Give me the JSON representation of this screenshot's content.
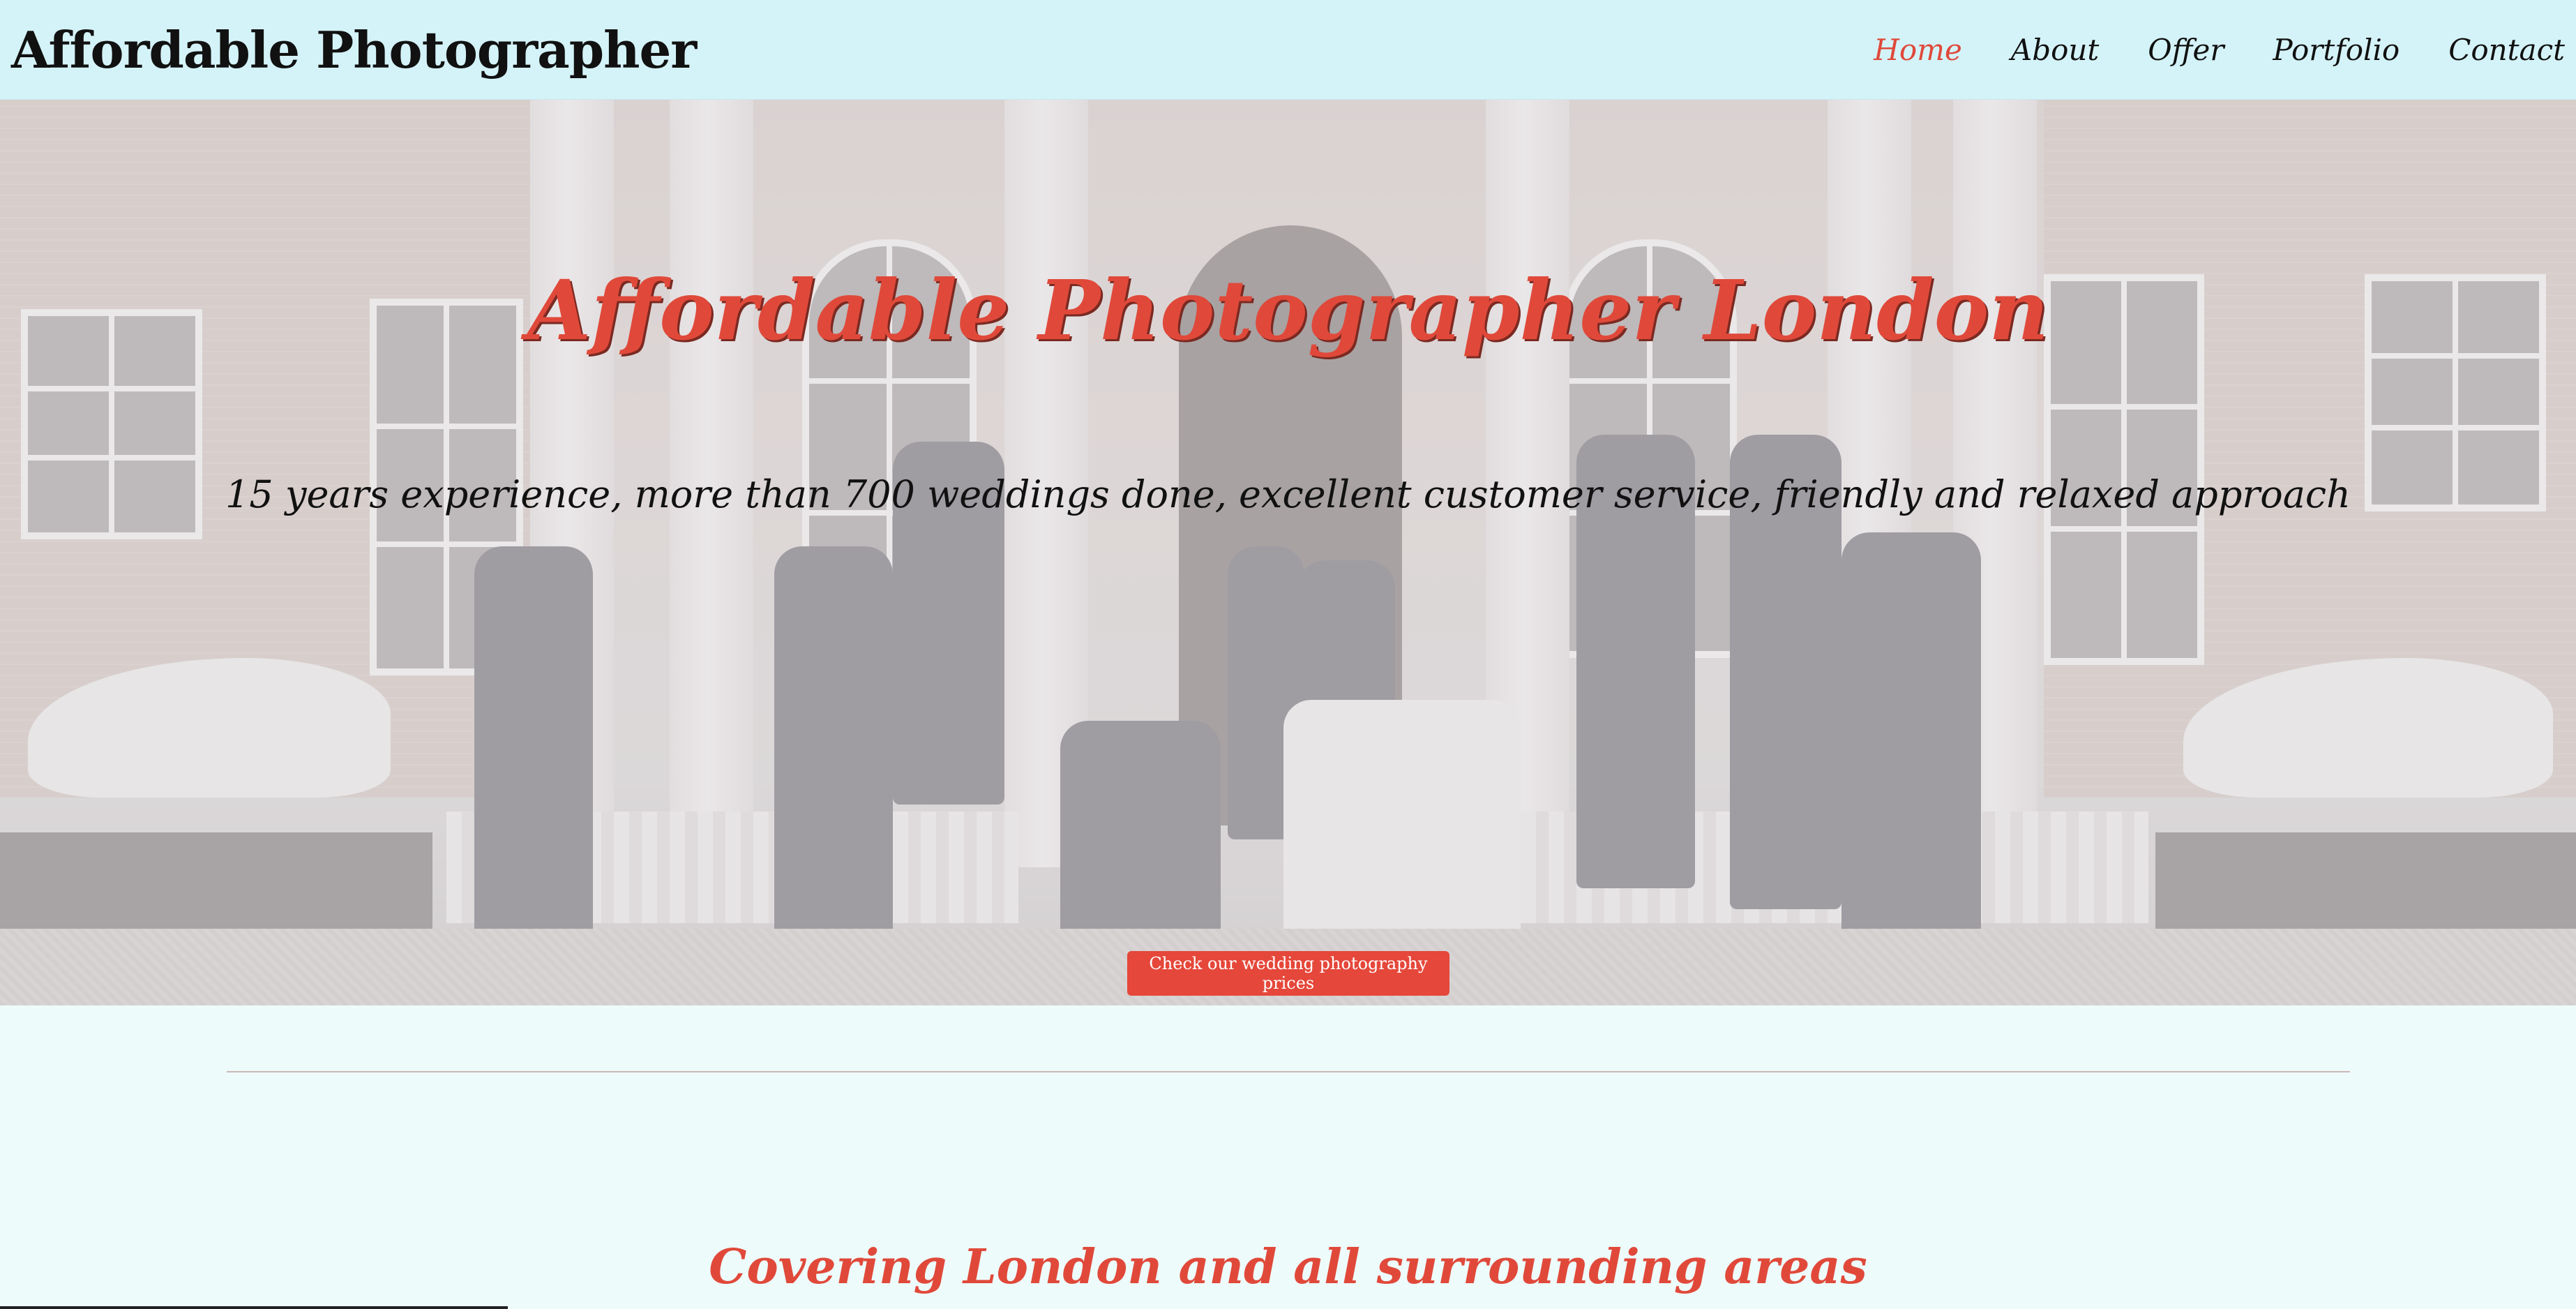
{
  "header": {
    "brand": "Affordable Photographer",
    "nav": [
      {
        "label": "Home",
        "active": true
      },
      {
        "label": "About",
        "active": false
      },
      {
        "label": "Offer",
        "active": false
      },
      {
        "label": "Portfolio",
        "active": false
      },
      {
        "label": "Contact",
        "active": false
      }
    ]
  },
  "hero": {
    "title": "Affordable Photographer London",
    "subtitle": "15 years experience, more than 700 weddings done, excellent customer service, friendly and relaxed approach",
    "cta_label": "Check our wedding photography prices"
  },
  "section": {
    "heading": "Covering London and all surrounding areas"
  },
  "colors": {
    "accent": "#e0493a",
    "header_bg": "#d4f3f8",
    "page_bg": "#eefbfb"
  }
}
